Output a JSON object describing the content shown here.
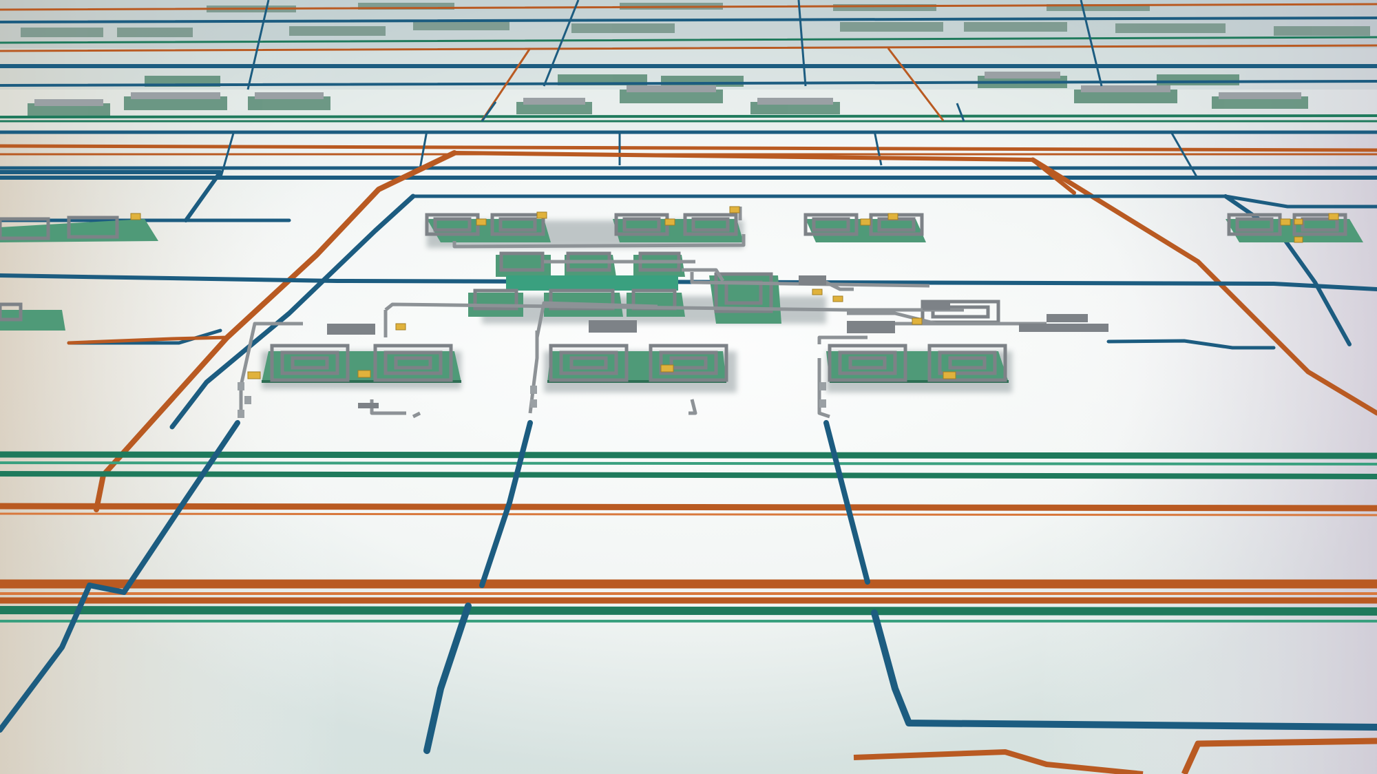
{
  "scene": {
    "kind": "isometric circuit layout render",
    "colors": {
      "bus_orange": "#b95a22",
      "bus_orange_light": "#d8783c",
      "bus_blue": "#1c5c80",
      "bus_blue_light": "#3f86ad",
      "bus_green": "#1f7a5c",
      "bus_green_light": "#3aa07f",
      "board_green": "#4f9a78",
      "board_green_light": "#86c5a6",
      "wire_gray": "#7d8287",
      "wire_gray_light": "#b3b8bc",
      "component_yellow": "#e0b23c",
      "background_top": "#c2d3d4",
      "background_bottom": "#b5c9c5",
      "floor": "#ffffff",
      "shadow": "#8f9ca0"
    },
    "icons": [
      "spiral-inductor-icon",
      "capacitor-icon",
      "trace-icon"
    ]
  }
}
